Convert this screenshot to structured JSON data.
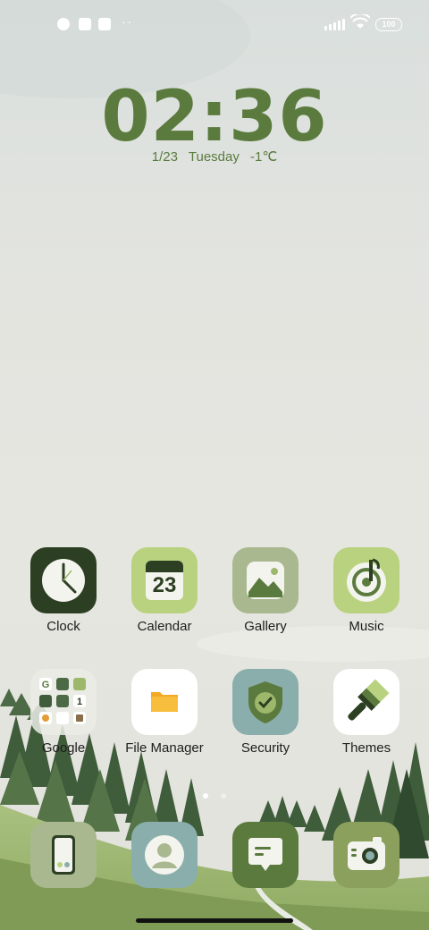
{
  "status_bar": {
    "icons": [
      "app-notification-icon",
      "square-notification-icon",
      "upload-icon"
    ],
    "more_dots": "··",
    "battery": "100"
  },
  "clock_widget": {
    "time": "02:36",
    "date": "1/23",
    "weekday": "Tuesday",
    "temperature": "-1℃"
  },
  "apps_row1": [
    {
      "label": "Clock",
      "icon": "clock-icon"
    },
    {
      "label": "Calendar",
      "icon": "calendar-icon",
      "day": "23"
    },
    {
      "label": "Gallery",
      "icon": "gallery-icon"
    },
    {
      "label": "Music",
      "icon": "music-icon"
    }
  ],
  "apps_row2": [
    {
      "label": "Google",
      "icon": "google-folder-icon"
    },
    {
      "label": "File Manager",
      "icon": "folder-icon"
    },
    {
      "label": "Security",
      "icon": "shield-icon"
    },
    {
      "label": "Themes",
      "icon": "brush-icon"
    }
  ],
  "dock": [
    {
      "icon": "phone-icon"
    },
    {
      "icon": "contacts-icon"
    },
    {
      "icon": "messages-icon"
    },
    {
      "icon": "camera-icon"
    }
  ],
  "colors": {
    "clock_green": "#5b7b3e",
    "dark_green": "#2d3f22",
    "light_green": "#b9d27f",
    "sage": "#a9b88f",
    "teal": "#8aaeab"
  }
}
